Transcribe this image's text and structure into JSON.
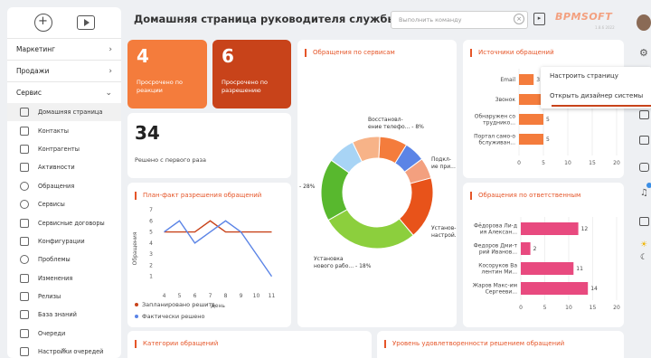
{
  "header": {
    "title": "Домашняя страница руководителя службы поддержки",
    "command_placeholder": "Выполнить команду",
    "logo_main": "ВРМ",
    "logo_accent": "SOFT",
    "logo_version": "1.8.6 2022"
  },
  "sidebar": {
    "groups": [
      {
        "label": "Маркетинг"
      },
      {
        "label": "Продажи"
      },
      {
        "label": "Сервис"
      }
    ],
    "items": [
      {
        "label": "Домашняя страница",
        "icon": "home-icon"
      },
      {
        "label": "Контакты",
        "icon": "contact-icon"
      },
      {
        "label": "Контрагенты",
        "icon": "company-icon"
      },
      {
        "label": "Активности",
        "icon": "flag-icon"
      },
      {
        "label": "Обращения",
        "icon": "alert-icon"
      },
      {
        "label": "Сервисы",
        "icon": "gear-icon"
      },
      {
        "label": "Сервисные договоры",
        "icon": "contract-icon"
      },
      {
        "label": "Конфигурации",
        "icon": "config-icon"
      },
      {
        "label": "Проблемы",
        "icon": "problem-icon"
      },
      {
        "label": "Изменения",
        "icon": "pencil-icon"
      },
      {
        "label": "Релизы",
        "icon": "release-icon"
      },
      {
        "label": "База знаний",
        "icon": "book-icon"
      },
      {
        "label": "Очереди",
        "icon": "queue-icon"
      },
      {
        "label": "Настройки очередей",
        "icon": "queue-settings-icon"
      }
    ],
    "collapse_label": "«"
  },
  "tiles": {
    "overdue_reaction": {
      "value": "4",
      "label": "Просрочено по реакции",
      "color": "#f47c3c"
    },
    "overdue_resolution": {
      "value": "6",
      "label": "Просрочено по разрешению",
      "color": "#c8431a"
    },
    "first_time": {
      "value": "34",
      "label": "Решено с первого раза"
    }
  },
  "cards": {
    "services": "Обращения по сервисам",
    "sources": "Источники обращений",
    "plan_fact": "План-факт разрешения обращений",
    "responsible": "Обращения по ответственным",
    "categories": "Категории обращений",
    "satisfaction": "Уровень удовлетворенности решением обращений"
  },
  "context_menu": {
    "items": [
      "Настроить страницу",
      "Открыть дизайнер системы"
    ]
  },
  "chart_data": [
    {
      "type": "pie",
      "title": "Обращения по сервисам",
      "labels": [
        "Восстановл-ение телефо... - 8%",
        "Подкл-ие при...",
        "Установ-настрой...",
        "Установка нового рабо... - 18%",
        "- 28%"
      ],
      "values": [
        8,
        6,
        6,
        18,
        28,
        18,
        8,
        8
      ],
      "colors": [
        "#f47c3c",
        "#5b84e6",
        "#f3a07f",
        "#e8531a",
        "#8ccf3d",
        "#58b82e",
        "#a8d4f5",
        "#f7b388"
      ]
    },
    {
      "type": "bar",
      "title": "Источники обращений",
      "categories": [
        "Email",
        "Звонок",
        "Обнаружен сотруднико...",
        "Портал само-обслуживан..."
      ],
      "values": [
        3,
        5,
        5,
        5
      ],
      "xticks": [
        "0",
        "5",
        "10",
        "15",
        "20"
      ],
      "xlim": [
        0,
        20
      ],
      "color": "#f47c3c"
    },
    {
      "type": "line",
      "title": "План-факт разрешения обращений",
      "xlabel": "День",
      "ylabel": "Обращения",
      "x": [
        4,
        5,
        6,
        7,
        8,
        9,
        10,
        11
      ],
      "yticks": [
        "1",
        "2",
        "3",
        "4",
        "5",
        "6",
        "7"
      ],
      "ylim": [
        0,
        7
      ],
      "series": [
        {
          "name": "Запланировано решить",
          "color": "#c8431a",
          "values": [
            5,
            5,
            5,
            6,
            5,
            5,
            5,
            5
          ]
        },
        {
          "name": "Фактически решено",
          "color": "#5b84e6",
          "values": [
            5,
            6,
            4,
            5,
            6,
            5,
            3,
            1
          ]
        }
      ]
    },
    {
      "type": "bar",
      "title": "Обращения по ответственным",
      "categories": [
        "Фёдорова Ли-дия Алексан...",
        "Федоров Дми-трий Иванов...",
        "Косоруков Валентин Ми...",
        "Жаров Макс-им Сергееви..."
      ],
      "values": [
        12,
        2,
        11,
        14
      ],
      "xticks": [
        "0",
        "5",
        "10",
        "15",
        "20"
      ],
      "xlim": [
        0,
        20
      ],
      "color": "#e84a7f"
    }
  ]
}
